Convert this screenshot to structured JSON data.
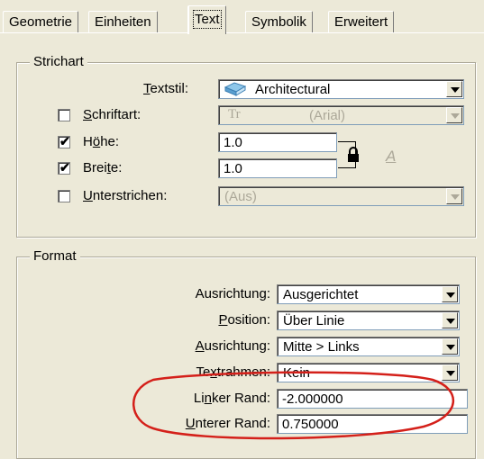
{
  "tabs": [
    {
      "label": "Geometrie"
    },
    {
      "label": "Einheiten"
    },
    {
      "label": "Text"
    },
    {
      "label": "Symbolik"
    },
    {
      "label": "Erweitert"
    }
  ],
  "strichart": {
    "legend": "Strichart",
    "textstil": {
      "label": "Textstil:",
      "value": "Architectural"
    },
    "schriftart": {
      "label": "Schriftart:",
      "checked": false,
      "icon_text": "Tr",
      "value": "(Arial)"
    },
    "hoehe": {
      "label": "Höhe:",
      "checked": true,
      "value": "1.0"
    },
    "breite": {
      "label": "Breite:",
      "checked": true,
      "value": "1.0"
    },
    "unterstrichen": {
      "label": "Unterstrichen:",
      "checked": false,
      "value": "(Aus)"
    },
    "checkmark": "✔",
    "ruler_icon_text": "A"
  },
  "format": {
    "legend": "Format",
    "ausrichtung1": {
      "label": "Ausrichtung:",
      "value": "Ausgerichtet"
    },
    "position": {
      "label": "Position:",
      "value": "Über Linie"
    },
    "ausrichtung2": {
      "label": "Ausrichtung:",
      "value": "Mitte > Links"
    },
    "textrahmen": {
      "label": "Textrahmen:",
      "value": "Kein"
    },
    "linker_rand": {
      "label": "Linker Rand:",
      "value": "-2.000000"
    },
    "unterer_rand": {
      "label": "Unterer Rand:",
      "value": "0.750000"
    }
  },
  "colors": {
    "annotation": "#d4201a",
    "window": "#ece9d8"
  }
}
